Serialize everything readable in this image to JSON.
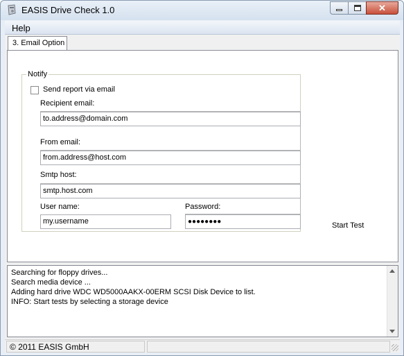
{
  "window": {
    "title": "EASIS Drive Check 1.0",
    "icon": "drive-check-app-icon",
    "close_color": "#c8503a"
  },
  "menu": {
    "items": [
      "Help"
    ]
  },
  "tabs": {
    "active_label": "3. Email Option"
  },
  "notify": {
    "group_title": "Notify",
    "send_report_label": "Send report via email",
    "send_report_checked": false,
    "recipient_label": "Recipient email:",
    "recipient_value": "to.address@domain.com",
    "from_label": "From email:",
    "from_value": "from.address@host.com",
    "smtp_label": "Smtp host:",
    "smtp_value": "smtp.host.com",
    "username_label": "User name:",
    "username_value": "my.username",
    "password_label": "Password:",
    "password_value": "●●●●●●●●"
  },
  "actions": {
    "start_test_label": "Start Test"
  },
  "log": {
    "lines": [
      "Searching for floppy drives...",
      "Search media device ...",
      "Adding hard drive WDC WD5000AAKX-00ERM SCSI Disk Device to list.",
      "INFO: Start tests by selecting a storage device"
    ]
  },
  "status": {
    "copyright": "© 2011 EASIS GmbH",
    "secondary": ""
  }
}
